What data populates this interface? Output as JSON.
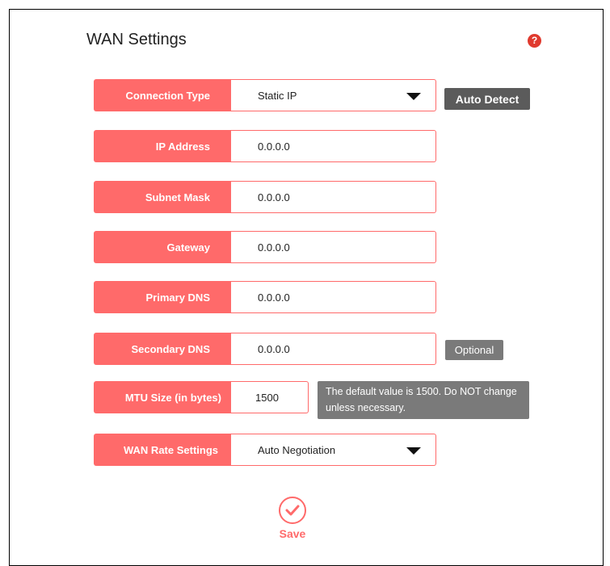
{
  "page": {
    "title": "WAN Settings",
    "help_icon": "?"
  },
  "form": {
    "connection_type": {
      "label": "Connection Type",
      "value": "Static IP"
    },
    "auto_detect_label": "Auto Detect",
    "ip_address": {
      "label": "IP Address",
      "value": "0.0.0.0"
    },
    "subnet_mask": {
      "label": "Subnet Mask",
      "value": "0.0.0.0"
    },
    "gateway": {
      "label": "Gateway",
      "value": "0.0.0.0"
    },
    "primary_dns": {
      "label": "Primary DNS",
      "value": "0.0.0.0"
    },
    "secondary_dns": {
      "label": "Secondary DNS",
      "value": "0.0.0.0"
    },
    "optional_label": "Optional",
    "mtu": {
      "label": "MTU Size (in bytes)",
      "value": "1500",
      "note": "The default value is 1500. Do NOT change unless necessary."
    },
    "wan_rate": {
      "label": "WAN Rate Settings",
      "value": "Auto Negotiation"
    }
  },
  "actions": {
    "save_label": "Save"
  },
  "colors": {
    "accent": "#ff6a6a",
    "button_dark": "#5b5b5b",
    "badge_gray": "#7a7a7a",
    "help_red": "#e03a2e"
  }
}
